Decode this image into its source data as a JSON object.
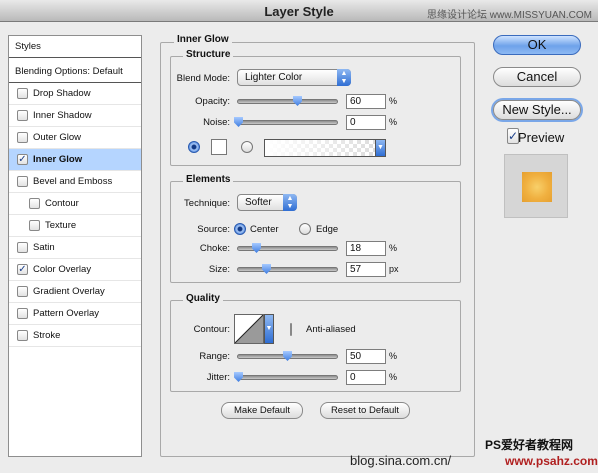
{
  "window": {
    "title": "Layer Style",
    "watermark_top": "思缘设计论坛 www.MISSYUAN.COM",
    "watermark_bottom": "blog.sina.com.cn/",
    "watermark_bottom2": "PS爱好者教程网",
    "watermark_bottom3": "www.psahz.com"
  },
  "sidebar": {
    "header": "Styles",
    "blending": "Blending Options: Default",
    "items": [
      {
        "label": "Drop Shadow",
        "checked": false
      },
      {
        "label": "Inner Shadow",
        "checked": false
      },
      {
        "label": "Outer Glow",
        "checked": false
      },
      {
        "label": "Inner Glow",
        "checked": true
      },
      {
        "label": "Bevel and Emboss",
        "checked": false
      },
      {
        "label": "Contour",
        "checked": false
      },
      {
        "label": "Texture",
        "checked": false
      },
      {
        "label": "Satin",
        "checked": false
      },
      {
        "label": "Color Overlay",
        "checked": true
      },
      {
        "label": "Gradient Overlay",
        "checked": false
      },
      {
        "label": "Pattern Overlay",
        "checked": false
      },
      {
        "label": "Stroke",
        "checked": false
      }
    ]
  },
  "panel": {
    "title": "Inner Glow",
    "structure": {
      "title": "Structure",
      "blend_mode_label": "Blend Mode:",
      "blend_mode_value": "Lighter Color",
      "opacity_label": "Opacity:",
      "opacity_value": "60",
      "opacity_unit": "%",
      "noise_label": "Noise:",
      "noise_value": "0",
      "noise_unit": "%"
    },
    "elements": {
      "title": "Elements",
      "technique_label": "Technique:",
      "technique_value": "Softer",
      "source_label": "Source:",
      "source_center": "Center",
      "source_edge": "Edge",
      "choke_label": "Choke:",
      "choke_value": "18",
      "choke_unit": "%",
      "size_label": "Size:",
      "size_value": "57",
      "size_unit": "px"
    },
    "quality": {
      "title": "Quality",
      "contour_label": "Contour:",
      "antialiased_label": "Anti-aliased",
      "range_label": "Range:",
      "range_value": "50",
      "range_unit": "%",
      "jitter_label": "Jitter:",
      "jitter_value": "0",
      "jitter_unit": "%"
    },
    "make_default": "Make Default",
    "reset_default": "Reset to Default"
  },
  "buttons": {
    "ok": "OK",
    "cancel": "Cancel",
    "new_style": "New Style...",
    "preview": "Preview"
  },
  "colors": {
    "accent": "#3f7de0",
    "selected_row": "#b5d5ff",
    "preview_swatch": "#f0b040"
  }
}
